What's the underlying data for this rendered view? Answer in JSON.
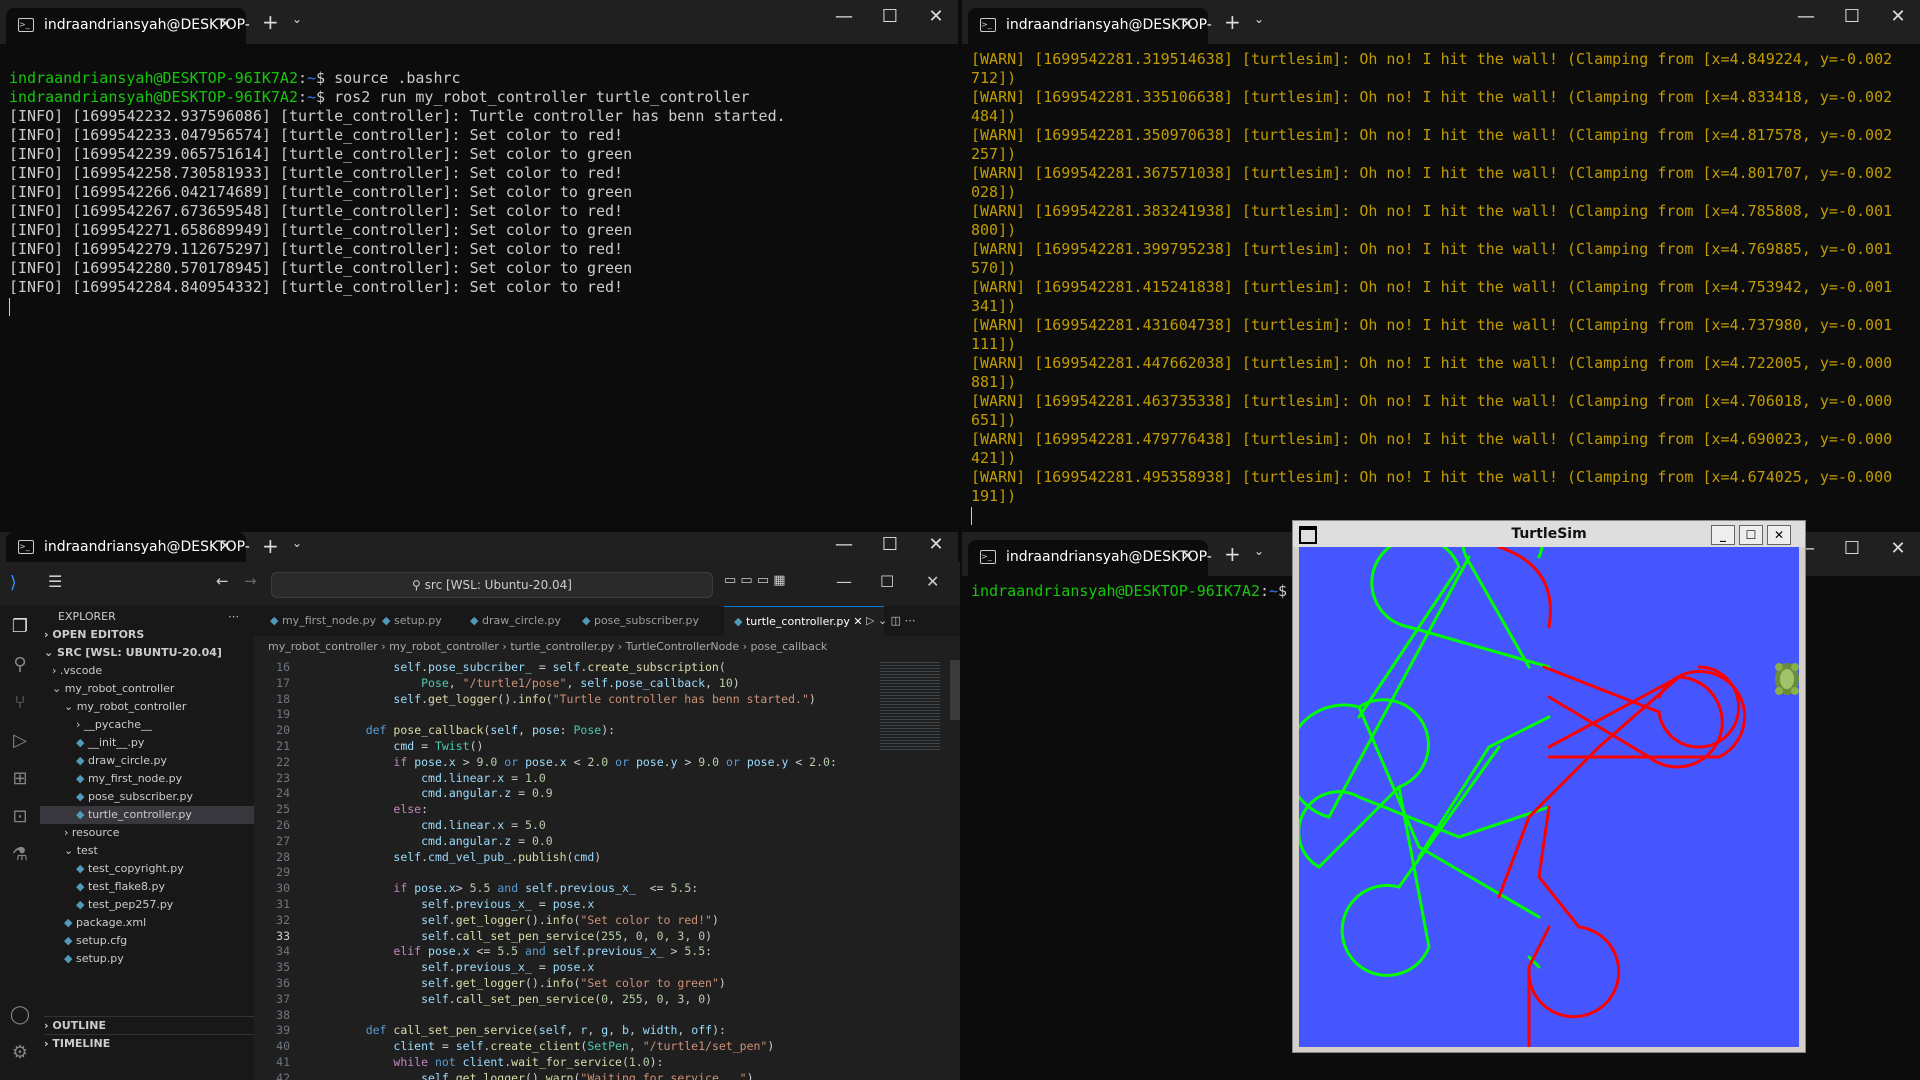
{
  "tab_title": "indraandriansyah@DESKTOP-",
  "term1": {
    "lines": [
      {
        "prompt": "indraandriansyah@DESKTOP-96IK7A2",
        "path": "~",
        "cmd": "$ source .bashrc"
      },
      {
        "prompt": "indraandriansyah@DESKTOP-96IK7A2",
        "path": "~",
        "cmd": "$ ros2 run my_robot_controller turtle_controller"
      }
    ],
    "logs": [
      "[INFO] [1699542232.937596086] [turtle_controller]: Turtle controller has benn started.",
      "[INFO] [1699542233.047956574] [turtle_controller]: Set color to red!",
      "[INFO] [1699542239.065751614] [turtle_controller]: Set color to green",
      "[INFO] [1699542258.730581933] [turtle_controller]: Set color to red!",
      "[INFO] [1699542266.042174689] [turtle_controller]: Set color to green",
      "[INFO] [1699542267.673659548] [turtle_controller]: Set color to red!",
      "[INFO] [1699542271.658689949] [turtle_controller]: Set color to green",
      "[INFO] [1699542279.112675297] [turtle_controller]: Set color to red!",
      "[INFO] [1699542280.570178945] [turtle_controller]: Set color to green",
      "[INFO] [1699542284.840954332] [turtle_controller]: Set color to red!"
    ]
  },
  "term2": {
    "warns": [
      "[WARN] [1699542281.319514638] [turtlesim]: Oh no! I hit the wall! (Clamping from [x=4.849224, y=-0.002",
      "712])",
      "[WARN] [1699542281.335106638] [turtlesim]: Oh no! I hit the wall! (Clamping from [x=4.833418, y=-0.002",
      "484])",
      "[WARN] [1699542281.350970638] [turtlesim]: Oh no! I hit the wall! (Clamping from [x=4.817578, y=-0.002",
      "257])",
      "[WARN] [1699542281.367571038] [turtlesim]: Oh no! I hit the wall! (Clamping from [x=4.801707, y=-0.002",
      "028])",
      "[WARN] [1699542281.383241938] [turtlesim]: Oh no! I hit the wall! (Clamping from [x=4.785808, y=-0.001",
      "800])",
      "[WARN] [1699542281.399795238] [turtlesim]: Oh no! I hit the wall! (Clamping from [x=4.769885, y=-0.001",
      "570])",
      "[WARN] [1699542281.415241838] [turtlesim]: Oh no! I hit the wall! (Clamping from [x=4.753942, y=-0.001",
      "341])",
      "[WARN] [1699542281.431604738] [turtlesim]: Oh no! I hit the wall! (Clamping from [x=4.737980, y=-0.001",
      "111])",
      "[WARN] [1699542281.447662038] [turtlesim]: Oh no! I hit the wall! (Clamping from [x=4.722005, y=-0.000",
      "881])",
      "[WARN] [1699542281.463735338] [turtlesim]: Oh no! I hit the wall! (Clamping from [x=4.706018, y=-0.000",
      "651])",
      "[WARN] [1699542281.479776438] [turtlesim]: Oh no! I hit the wall! (Clamping from [x=4.690023, y=-0.000",
      "421])",
      "[WARN] [1699542281.495358938] [turtlesim]: Oh no! I hit the wall! (Clamping from [x=4.674025, y=-0.000",
      "191])"
    ]
  },
  "term4": {
    "prompt": "indraandriansyah@DESKTOP-96IK7A2",
    "path": "~",
    "cmd": "$"
  },
  "vscode": {
    "search": "src [WSL: Ubuntu-20.04]",
    "explorer_title": "EXPLORER",
    "open_editors": "OPEN EDITORS",
    "root": "SRC [WSL: UBUNTU-20.04]",
    "tree": [
      ".vscode",
      "my_robot_controller",
      "my_robot_controller",
      "__pycache__",
      "__init__.py",
      "draw_circle.py",
      "my_first_node.py",
      "pose_subscriber.py",
      "turtle_controller.py",
      "resource",
      "test",
      "test_copyright.py",
      "test_flake8.py",
      "test_pep257.py",
      "package.xml",
      "setup.cfg",
      "setup.py"
    ],
    "outline": "OUTLINE",
    "timeline": "TIMELINE",
    "tabs": [
      "my_first_node.py",
      "setup.py",
      "draw_circle.py",
      "pose_subscriber.py",
      "turtle_controller.py"
    ],
    "crumbs": [
      "my_robot_controller",
      "my_robot_controller",
      "turtle_controller.py",
      "TurtleControllerNode",
      "pose_callback"
    ],
    "line_numbers": [
      "16",
      "17",
      "18",
      "19",
      "20",
      "21",
      "22",
      "23",
      "24",
      "25",
      "26",
      "27",
      "28",
      "29",
      "30",
      "31",
      "32",
      "33",
      "34",
      "35",
      "36",
      "37",
      "38",
      "39",
      "40",
      "41",
      "42"
    ]
  },
  "turtlesim": {
    "title": "TurtleSim",
    "bg": "#4556ff"
  },
  "colors": {
    "prompt_green": "#16c60c",
    "path_blue": "#3b78ff",
    "warn_yellow": "#c19c00",
    "pen_red": "#ff0000",
    "pen_green": "#00ff00"
  }
}
